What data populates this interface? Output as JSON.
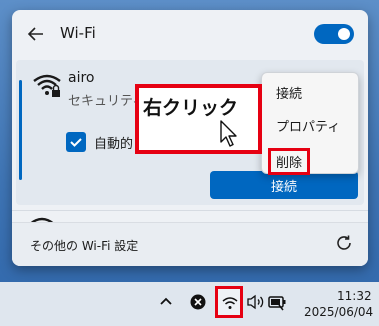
{
  "wifi_panel": {
    "title": "Wi-Fi",
    "network": {
      "name": "airo",
      "status": "セキュリティ",
      "auto_label": "自動的",
      "connect_label": "接続"
    },
    "footer_link": "その他の Wi-Fi 設定"
  },
  "context_menu": {
    "items": [
      "接続",
      "プロパティ",
      "削除"
    ]
  },
  "callout": {
    "text": "右クリック"
  },
  "taskbar": {
    "time": "11:32",
    "date": "2025/06/04"
  },
  "colors": {
    "accent": "#0067c0",
    "highlight": "#e60012"
  },
  "icons": [
    "back-arrow-icon",
    "wifi-icon",
    "checkbox-icon",
    "refresh-icon",
    "cursor-icon",
    "chevron-up-icon",
    "close-circle-icon",
    "volume-icon",
    "battery-icon"
  ]
}
